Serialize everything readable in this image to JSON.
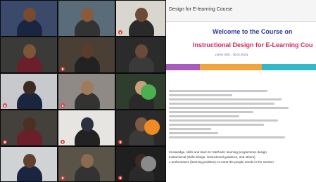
{
  "participants": [
    {
      "name": "",
      "muted": false
    },
    {
      "name": "",
      "muted": false
    },
    {
      "name": "",
      "muted": true
    },
    {
      "name": "",
      "muted": false
    },
    {
      "name": "",
      "muted": true
    },
    {
      "name": "",
      "muted": false
    },
    {
      "name": "",
      "muted": true
    },
    {
      "name": "",
      "muted": true
    },
    {
      "name": "",
      "muted": false
    },
    {
      "name": "",
      "muted": true
    },
    {
      "name": "",
      "muted": true
    },
    {
      "name": "",
      "muted": true
    },
    {
      "name": "",
      "muted": false
    },
    {
      "name": "",
      "muted": true
    },
    {
      "name": "",
      "muted": true
    }
  ],
  "shared": {
    "header": "Design for E-learning Course",
    "welcome": "Welcome to the Course on",
    "course": "Instructional Design for E-Learning Cou",
    "dates": "(18.01.2021 - 30.01.2021)",
    "band_label": "",
    "para1": "Knowledge, skills and learn to: Methods; learning programmes design",
    "para2": "Instructional (skills design; instructional guidance, and others)",
    "para3": "1 performance (learning problem): to meet the people needs in the session"
  },
  "colors": {
    "welcome": "#2e3aa5",
    "course": "#d0285a",
    "band1": "#a75bbf",
    "band2": "#f2a33b",
    "band3": "#31b9c9"
  }
}
